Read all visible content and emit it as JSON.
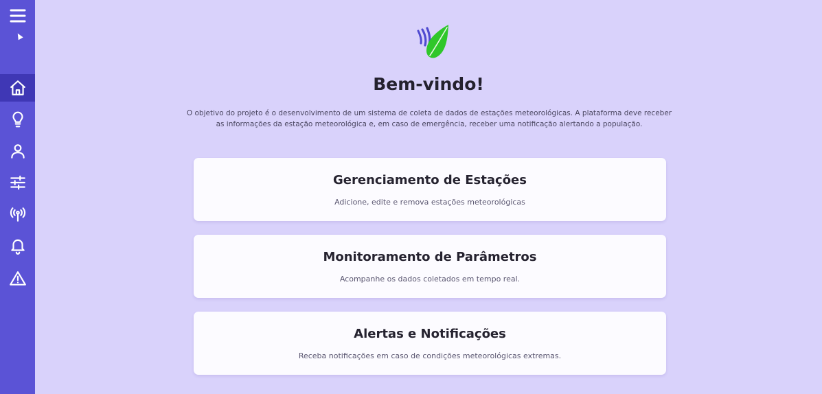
{
  "sidebar": {
    "menu_icon": "hamburger-menu-icon",
    "items": [
      {
        "name": "home",
        "icon": "home-icon",
        "active": true
      },
      {
        "name": "lightbulb",
        "icon": "lightbulb-icon",
        "active": false
      },
      {
        "name": "user",
        "icon": "user-icon",
        "active": false
      },
      {
        "name": "settings",
        "icon": "sliders-icon",
        "active": false
      },
      {
        "name": "stations",
        "icon": "antenna-icon",
        "active": false
      },
      {
        "name": "notifications",
        "icon": "bell-icon",
        "active": false
      },
      {
        "name": "alerts",
        "icon": "warning-icon",
        "active": false
      }
    ]
  },
  "colors": {
    "background": "#d9d2fb",
    "sidebar": "#5b53d6",
    "sidebar_active": "#3f37b5",
    "card": "#fcfbff",
    "logo_green": "#2fc72a",
    "logo_stripes": "#4f4ad0"
  },
  "main": {
    "logo_icon": "leaf-wind-logo",
    "title": "Bem-vindo!",
    "intro": "O objetivo do projeto é o desenvolvimento de um sistema de coleta de dados de estações meteorológicas. A plataforma deve receber as informações da estação meteorológica e, em caso de emergência, receber uma notificação alertando a população.",
    "cards": [
      {
        "title": "Gerenciamento de Estações",
        "description": "Adicione, edite e remova estações meteorológicas"
      },
      {
        "title": "Monitoramento de Parâmetros",
        "description": "Acompanhe os dados coletados em tempo real."
      },
      {
        "title": "Alertas e Notificações",
        "description": "Receba notificações em caso de condições meteorológicas extremas."
      }
    ]
  }
}
